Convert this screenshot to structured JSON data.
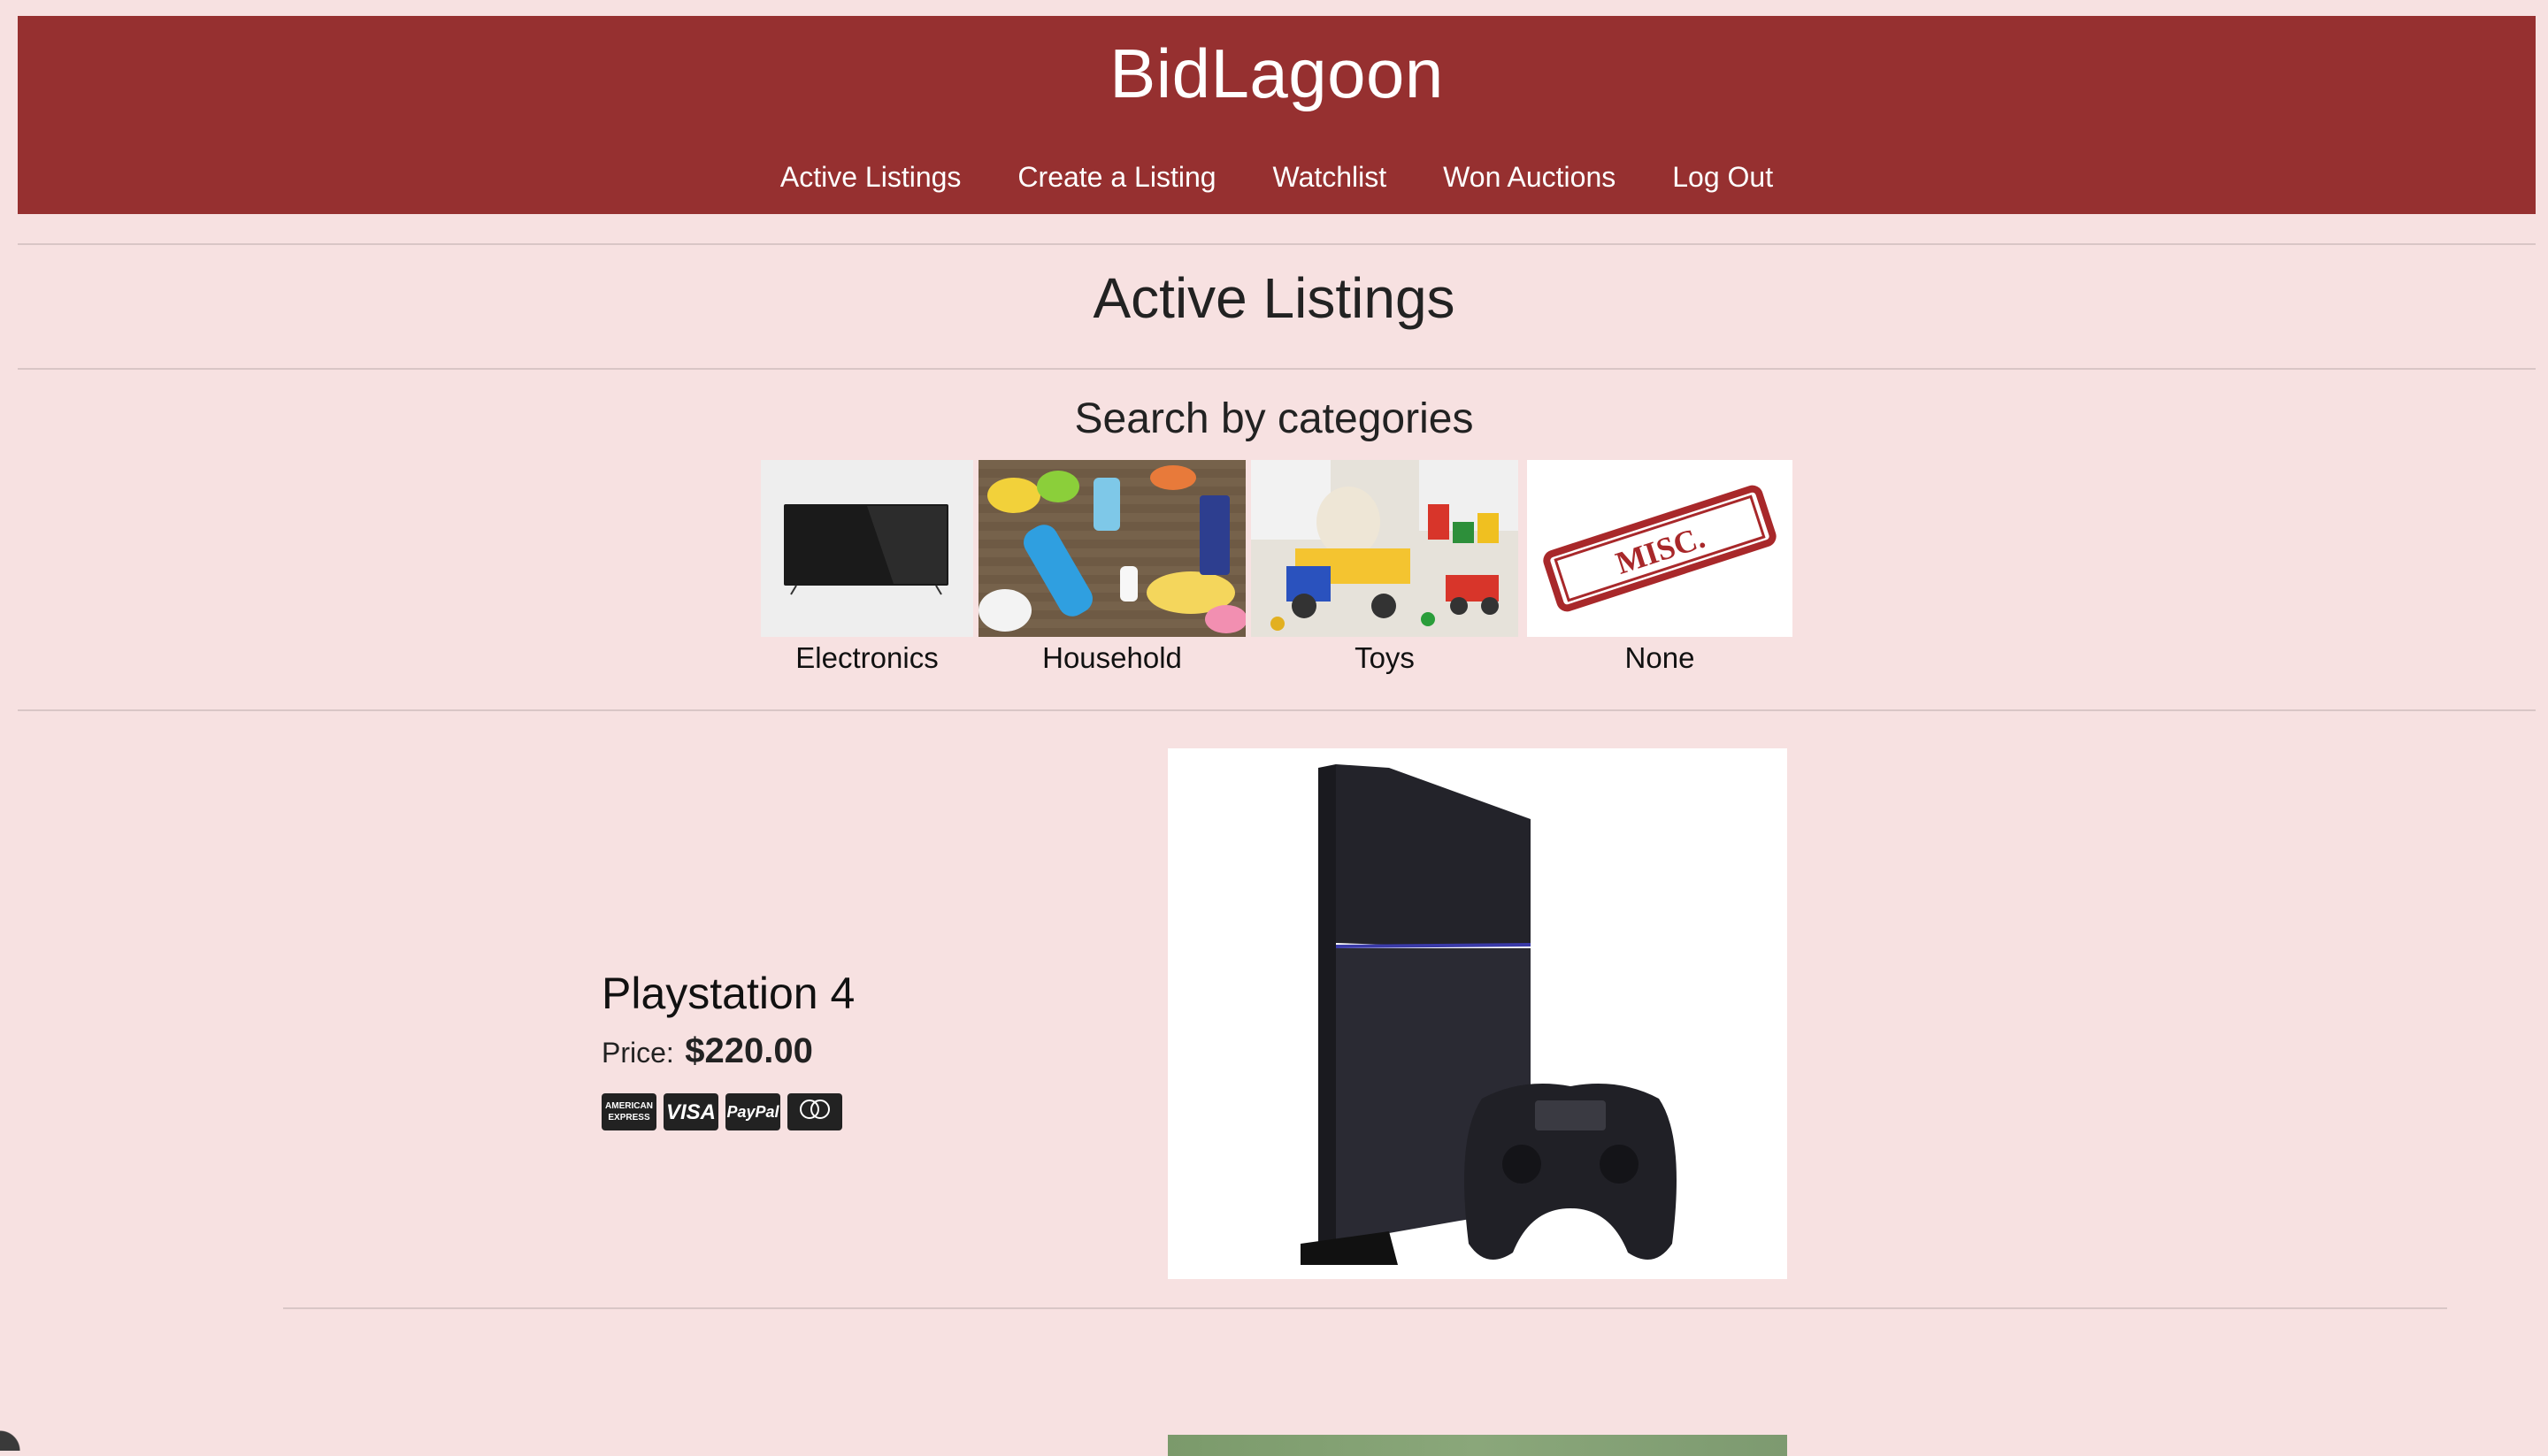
{
  "header": {
    "brand": "BidLagoon",
    "nav": [
      "Active Listings",
      "Create a Listing",
      "Watchlist",
      "Won Auctions",
      "Log Out"
    ]
  },
  "main": {
    "title": "Active Listings",
    "categories_heading": "Search by categories",
    "categories": [
      {
        "label": "Electronics",
        "icon": "tv-image"
      },
      {
        "label": "Household",
        "icon": "cleaning-supplies-image"
      },
      {
        "label": "Toys",
        "icon": "toys-image"
      },
      {
        "label": "None",
        "icon": "miscellaneous-stamp-image"
      }
    ],
    "listings": [
      {
        "title": "Playstation 4",
        "price_label": "Price:",
        "price": "$220.00",
        "payment_methods": [
          "AMERICAN EXPRESS",
          "VISA",
          "PayPal",
          "mastercard"
        ],
        "image": "playstation-4-console-image"
      }
    ]
  },
  "colors": {
    "header_bg": "#963030",
    "page_bg": "#f7e1e1",
    "text": "#222222"
  }
}
